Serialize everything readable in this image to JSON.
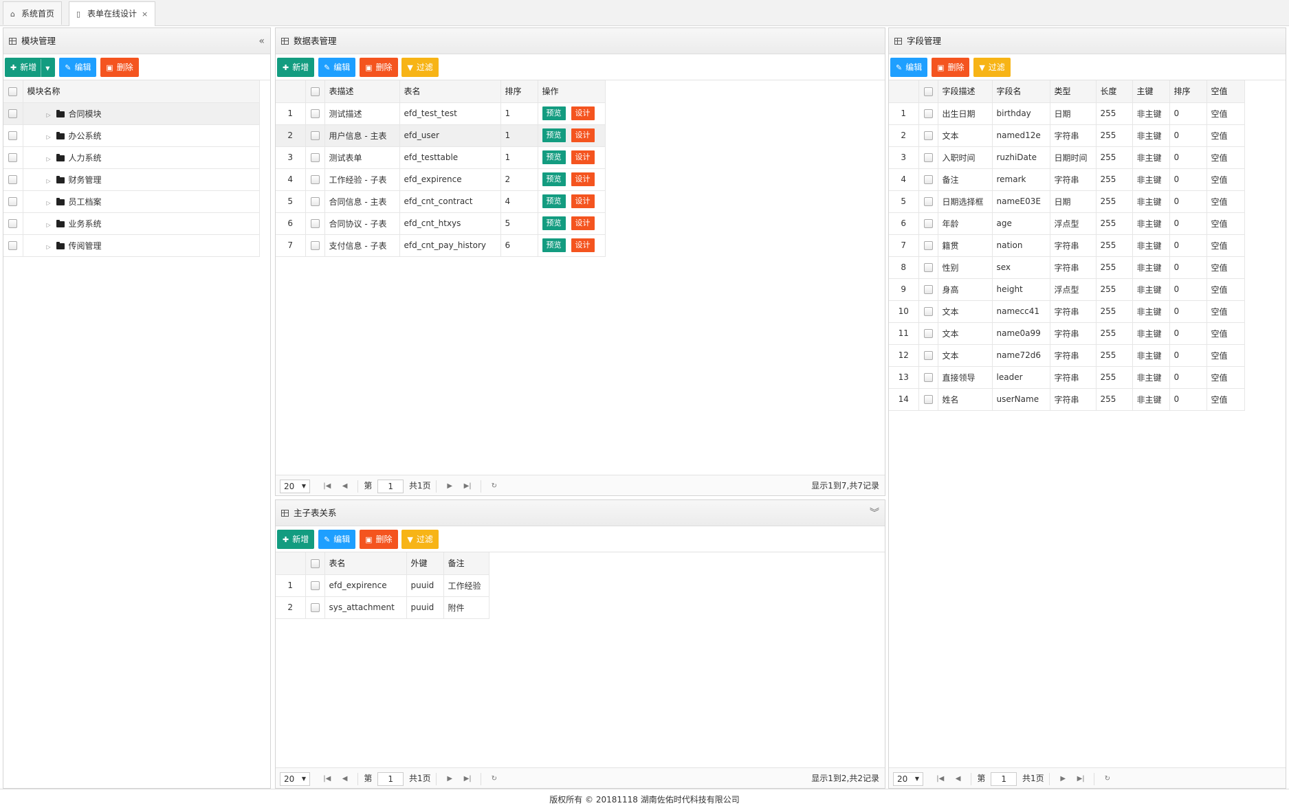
{
  "tabs": [
    {
      "label": "系统首页"
    },
    {
      "label": "表单在线设计"
    }
  ],
  "module_panel": {
    "title": "模块管理",
    "buttons": {
      "add": "新增",
      "edit": "编辑",
      "delete": "删除"
    },
    "column": "模块名称",
    "items": [
      "合同模块",
      "办公系统",
      "人力系统",
      "财务管理",
      "员工档案",
      "业务系统",
      "传阅管理"
    ]
  },
  "table_panel": {
    "title": "数据表管理",
    "buttons": {
      "add": "新增",
      "edit": "编辑",
      "delete": "删除",
      "filter": "过滤"
    },
    "columns": [
      "表描述",
      "表名",
      "排序",
      "操作"
    ],
    "action_labels": {
      "preview": "预览",
      "design": "设计"
    },
    "rows": [
      {
        "n": "1",
        "desc": "测试描述",
        "name": "efd_test_test",
        "sort": "1"
      },
      {
        "n": "2",
        "desc": "用户信息 - 主表",
        "name": "efd_user",
        "sort": "1"
      },
      {
        "n": "3",
        "desc": "测试表单",
        "name": "efd_testtable",
        "sort": "1"
      },
      {
        "n": "4",
        "desc": "工作经验 - 子表",
        "name": "efd_expirence",
        "sort": "2"
      },
      {
        "n": "5",
        "desc": "合同信息 - 主表",
        "name": "efd_cnt_contract",
        "sort": "4"
      },
      {
        "n": "6",
        "desc": "合同协议 - 子表",
        "name": "efd_cnt_htxys",
        "sort": "5"
      },
      {
        "n": "7",
        "desc": "支付信息 - 子表",
        "name": "efd_cnt_pay_history",
        "sort": "6"
      }
    ],
    "pager": {
      "size": "20",
      "page_prefix": "第",
      "page": "1",
      "total_pages": "共1页",
      "info": "显示1到7,共7记录"
    }
  },
  "relation_panel": {
    "title": "主子表关系",
    "buttons": {
      "add": "新增",
      "edit": "编辑",
      "delete": "删除",
      "filter": "过滤"
    },
    "columns": [
      "表名",
      "外键",
      "备注"
    ],
    "rows": [
      {
        "n": "1",
        "name": "efd_expirence",
        "fk": "puuid",
        "note": "工作经验"
      },
      {
        "n": "2",
        "name": "sys_attachment",
        "fk": "puuid",
        "note": "附件"
      }
    ],
    "pager": {
      "size": "20",
      "page_prefix": "第",
      "page": "1",
      "total_pages": "共1页",
      "info": "显示1到2,共2记录"
    }
  },
  "field_panel": {
    "title": "字段管理",
    "buttons": {
      "edit": "编辑",
      "delete": "删除",
      "filter": "过滤"
    },
    "columns": [
      "字段描述",
      "字段名",
      "类型",
      "长度",
      "主键",
      "排序",
      "空值"
    ],
    "rows": [
      {
        "n": "1",
        "desc": "出生日期",
        "name": "birthday",
        "type": "日期",
        "len": "255",
        "pk": "非主键",
        "sort": "0",
        "null": "空值"
      },
      {
        "n": "2",
        "desc": "文本",
        "name": "named12e",
        "type": "字符串",
        "len": "255",
        "pk": "非主键",
        "sort": "0",
        "null": "空值"
      },
      {
        "n": "3",
        "desc": "入职时间",
        "name": "ruzhiDate",
        "type": "日期时间",
        "len": "255",
        "pk": "非主键",
        "sort": "0",
        "null": "空值"
      },
      {
        "n": "4",
        "desc": "备注",
        "name": "remark",
        "type": "字符串",
        "len": "255",
        "pk": "非主键",
        "sort": "0",
        "null": "空值"
      },
      {
        "n": "5",
        "desc": "日期选择框",
        "name": "nameE03E",
        "type": "日期",
        "len": "255",
        "pk": "非主键",
        "sort": "0",
        "null": "空值"
      },
      {
        "n": "6",
        "desc": "年龄",
        "name": "age",
        "type": "浮点型",
        "len": "255",
        "pk": "非主键",
        "sort": "0",
        "null": "空值"
      },
      {
        "n": "7",
        "desc": "籍贯",
        "name": "nation",
        "type": "字符串",
        "len": "255",
        "pk": "非主键",
        "sort": "0",
        "null": "空值"
      },
      {
        "n": "8",
        "desc": "性别",
        "name": "sex",
        "type": "字符串",
        "len": "255",
        "pk": "非主键",
        "sort": "0",
        "null": "空值"
      },
      {
        "n": "9",
        "desc": "身高",
        "name": "height",
        "type": "浮点型",
        "len": "255",
        "pk": "非主键",
        "sort": "0",
        "null": "空值"
      },
      {
        "n": "10",
        "desc": "文本",
        "name": "namecc41",
        "type": "字符串",
        "len": "255",
        "pk": "非主键",
        "sort": "0",
        "null": "空值"
      },
      {
        "n": "11",
        "desc": "文本",
        "name": "name0a99",
        "type": "字符串",
        "len": "255",
        "pk": "非主键",
        "sort": "0",
        "null": "空值"
      },
      {
        "n": "12",
        "desc": "文本",
        "name": "name72d6",
        "type": "字符串",
        "len": "255",
        "pk": "非主键",
        "sort": "0",
        "null": "空值"
      },
      {
        "n": "13",
        "desc": "直接领导",
        "name": "leader",
        "type": "字符串",
        "len": "255",
        "pk": "非主键",
        "sort": "0",
        "null": "空值"
      },
      {
        "n": "14",
        "desc": "姓名",
        "name": "userName",
        "type": "字符串",
        "len": "255",
        "pk": "非主键",
        "sort": "0",
        "null": "空值"
      }
    ],
    "pager": {
      "size": "20",
      "page_prefix": "第",
      "page": "1",
      "total_pages": "共1页"
    }
  },
  "footer": "版权所有 © 20181118 湖南佐佑时代科技有限公司",
  "colors": {
    "green": "#139c80",
    "blue": "#1e9fff",
    "red": "#f4541f",
    "yellow": "#f7b416"
  }
}
